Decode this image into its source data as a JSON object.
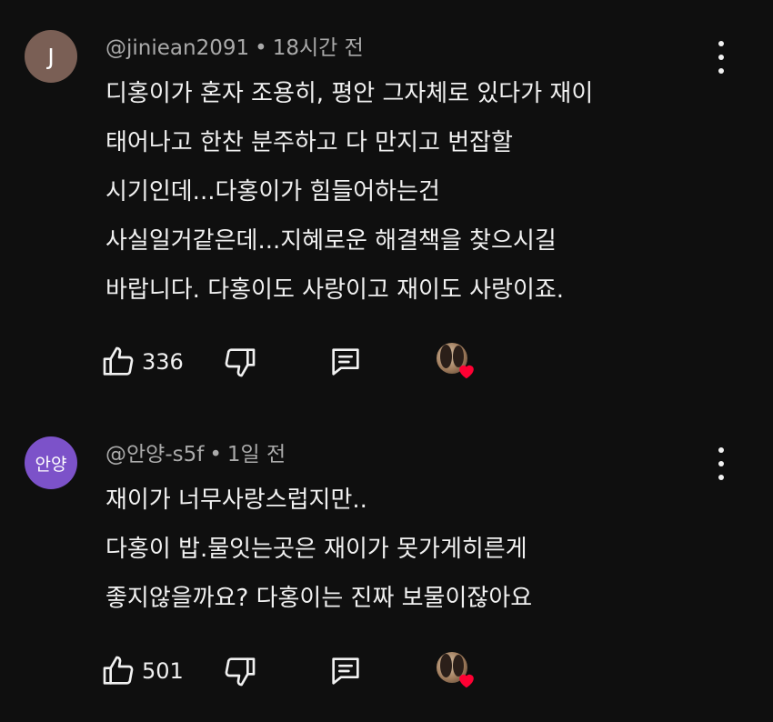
{
  "comments": [
    {
      "avatar_letter": "J",
      "author": "@jiniean2091",
      "separator": "•",
      "time": "18시간 전",
      "lines": [
        "디홍이가 혼자 조용히, 평안 그자체로 있다가 재이",
        "태어나고 한찬 분주하고 다 만지고 번잡할",
        "시기인데...다홍이가 힘들어하는건",
        "사실일거같은데...지혜로운 해결책을 찾으시길",
        "바랍니다.  다홍이도 사랑이고 재이도 사랑이죠."
      ],
      "likes": "336",
      "icons": {
        "like": "thumbs-up-icon",
        "dislike": "thumbs-down-icon",
        "reply": "reply-comment-icon",
        "more": "more-vertical-icon",
        "creator_heart": "creator-heart-icon"
      }
    },
    {
      "avatar_letter": "안양",
      "author": "@안양-s5f",
      "separator": "•",
      "time": "1일 전",
      "lines": [
        "재이가 너무사랑스럽지만..",
        "다홍이 밥.물잇는곳은 재이가 못가게히른게",
        "좋지않을까요? 다홍이는 진짜 보물이잖아요"
      ],
      "likes": "501",
      "icons": {
        "like": "thumbs-up-icon",
        "dislike": "thumbs-down-icon",
        "reply": "reply-comment-icon",
        "more": "more-vertical-icon",
        "creator_heart": "creator-heart-icon"
      }
    }
  ],
  "colors": {
    "background": "#0f0f0f",
    "text": "#f1f1f1",
    "meta": "#aaaaaa",
    "avatar_j": "#7a5f55",
    "avatar_k": "#7c52c9",
    "heart": "#ff0033"
  }
}
